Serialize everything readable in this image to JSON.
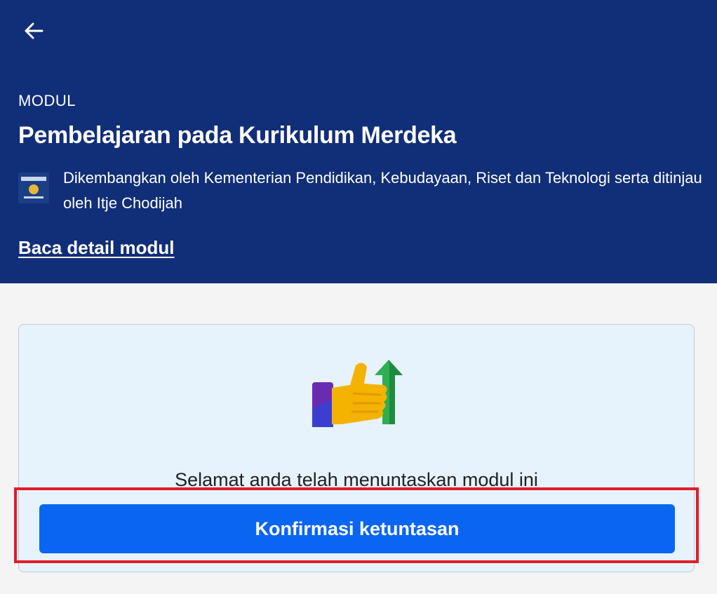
{
  "header": {
    "back_icon": "arrow-left-icon",
    "eyebrow": "MODUL",
    "title": "Pembelajaran pada Kurikulum Merdeka",
    "publisher_logo_icon": "kemendikbud-logo",
    "publisher_text": "Dikembangkan oleh Kementerian Pendidikan, Kebudayaan, Riset dan Teknologi serta ditinjau oleh Itje Chodijah",
    "detail_link": "Baca detail modul",
    "background_color": "#112e78"
  },
  "completion_card": {
    "illustration_icon": "thumbs-up-growth-icon",
    "message": "Selamat anda telah menuntaskan modul ini",
    "confirm_button": "Konfirmasi ketuntasan",
    "button_color": "#0a66f0"
  },
  "annotation": {
    "highlight_color": "#e11d2a"
  }
}
